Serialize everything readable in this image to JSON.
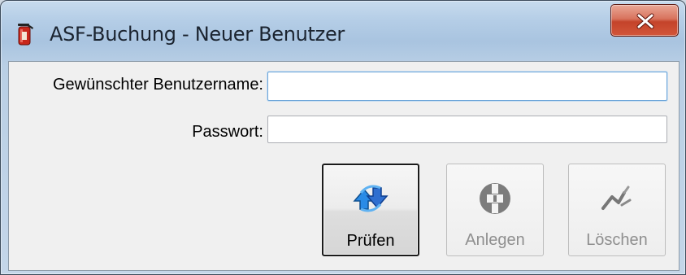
{
  "window": {
    "title": "ASF-Buchung - Neuer Benutzer",
    "app_icon": "fire-extinguisher-icon",
    "close_icon": "close-icon"
  },
  "form": {
    "username_label": "Gewünschter Benutzername:",
    "username_value": "",
    "password_label": "Passwort:",
    "password_value": ""
  },
  "buttons": {
    "pruefen": {
      "label": "Prüfen",
      "icon": "refresh-arrows-icon",
      "enabled": true
    },
    "anlegen": {
      "label": "Anlegen",
      "icon": "add-plus-icon",
      "enabled": false
    },
    "loeschen": {
      "label": "Löschen",
      "icon": "delete-icon",
      "enabled": false
    }
  },
  "colors": {
    "accent_blue": "#2f7fd8",
    "close_red": "#c4432a",
    "disabled_gray": "#8f8f8f"
  }
}
